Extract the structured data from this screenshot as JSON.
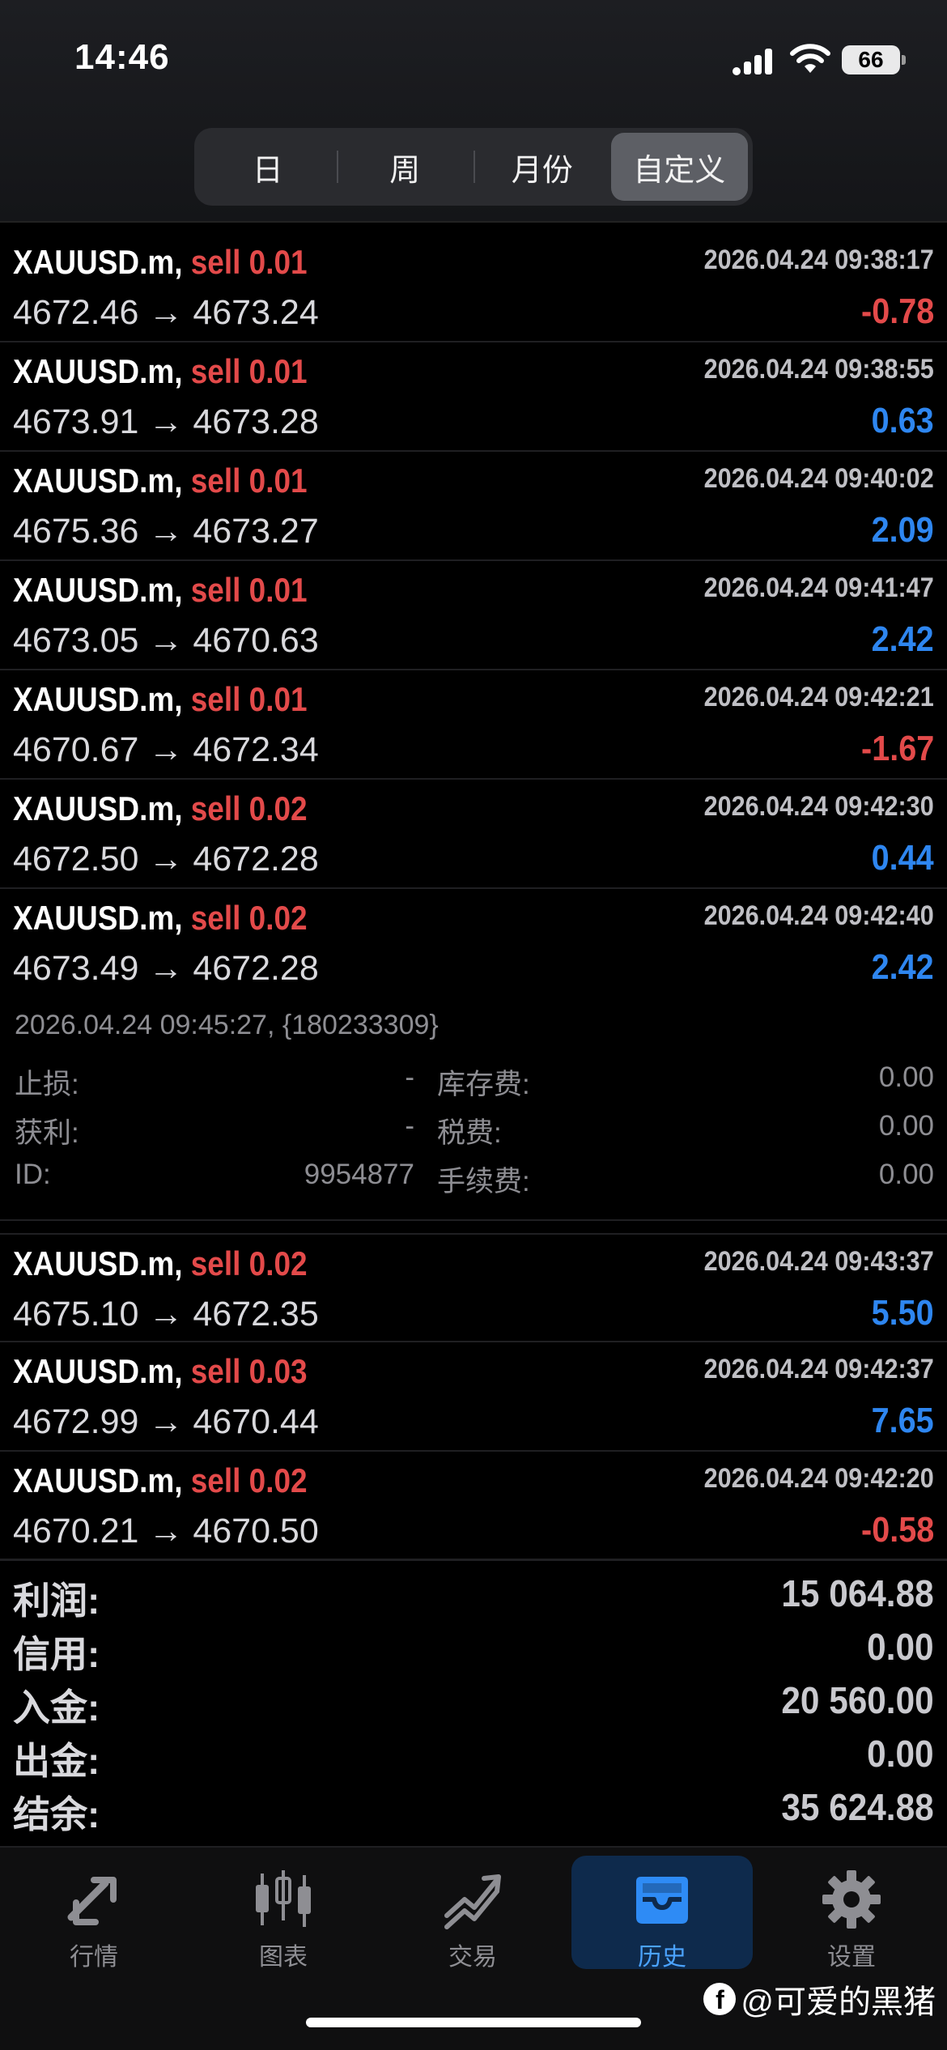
{
  "status_bar": {
    "time": "14:46",
    "battery": "66"
  },
  "tabs": {
    "day": "日",
    "week": "周",
    "month": "月份",
    "custom": "自定义"
  },
  "trades": [
    {
      "symbol": "XAUUSD.m,",
      "type": "sell",
      "volume": "0.01",
      "datetime": "2026.04.24 09:38:17",
      "prices": "4672.46 → 4673.24",
      "profit": "-0.78"
    },
    {
      "symbol": "XAUUSD.m,",
      "type": "sell",
      "volume": "0.01",
      "datetime": "2026.04.24 09:38:55",
      "prices": "4673.91 → 4673.28",
      "profit": "0.63"
    },
    {
      "symbol": "XAUUSD.m,",
      "type": "sell",
      "volume": "0.01",
      "datetime": "2026.04.24 09:40:02",
      "prices": "4675.36 → 4673.27",
      "profit": "2.09"
    },
    {
      "symbol": "XAUUSD.m,",
      "type": "sell",
      "volume": "0.01",
      "datetime": "2026.04.24 09:41:47",
      "prices": "4673.05 → 4670.63",
      "profit": "2.42"
    },
    {
      "symbol": "XAUUSD.m,",
      "type": "sell",
      "volume": "0.01",
      "datetime": "2026.04.24 09:42:21",
      "prices": "4670.67 → 4672.34",
      "profit": "-1.67"
    },
    {
      "symbol": "XAUUSD.m,",
      "type": "sell",
      "volume": "0.02",
      "datetime": "2026.04.24 09:42:30",
      "prices": "4672.50 → 4672.28",
      "profit": "0.44"
    },
    {
      "symbol": "XAUUSD.m,",
      "type": "sell",
      "volume": "0.02",
      "datetime": "2026.04.24 09:42:40",
      "prices": "4673.49 → 4672.28",
      "profit": "2.42"
    },
    {
      "symbol": "XAUUSD.m,",
      "type": "sell",
      "volume": "0.02",
      "datetime": "2026.04.24 09:43:37",
      "prices": "4675.10 → 4672.35",
      "profit": "5.50"
    },
    {
      "symbol": "XAUUSD.m,",
      "type": "sell",
      "volume": "0.03",
      "datetime": "2026.04.24 09:42:37",
      "prices": "4672.99 → 4670.44",
      "profit": "7.65"
    },
    {
      "symbol": "XAUUSD.m,",
      "type": "sell",
      "volume": "0.02",
      "datetime": "2026.04.24 09:42:20",
      "prices": "4670.21 → 4670.50",
      "profit": "-0.58"
    }
  ],
  "details": {
    "header": "2026.04.24 09:45:27, {180233309}",
    "stop_loss_label": "止损:",
    "stop_loss_value": "-",
    "take_profit_label": "获利:",
    "take_profit_value": "-",
    "id_label": "ID:",
    "id_value": "9954877",
    "swap_label": "库存费:",
    "swap_value": "0.00",
    "tax_label": "税费:",
    "tax_value": "0.00",
    "commission_label": "手续费:",
    "commission_value": "0.00"
  },
  "summary": {
    "profit_label": "利润:",
    "profit_value": "15 064.88",
    "credit_label": "信用:",
    "credit_value": "0.00",
    "deposit_label": "入金:",
    "deposit_value": "20 560.00",
    "withdrawal_label": "出金:",
    "withdrawal_value": "0.00",
    "balance_label": "结余:",
    "balance_value": "35 624.88"
  },
  "tabbar": {
    "quotes": "行情",
    "charts": "图表",
    "trade": "交易",
    "history": "历史",
    "settings": "设置"
  },
  "watermark": "@可爱的黑猪",
  "colors": {
    "sell": "#e34a4a",
    "loss": "#e34a4a",
    "gain": "#2e86f0",
    "active_tab": "#4ba3ff"
  }
}
